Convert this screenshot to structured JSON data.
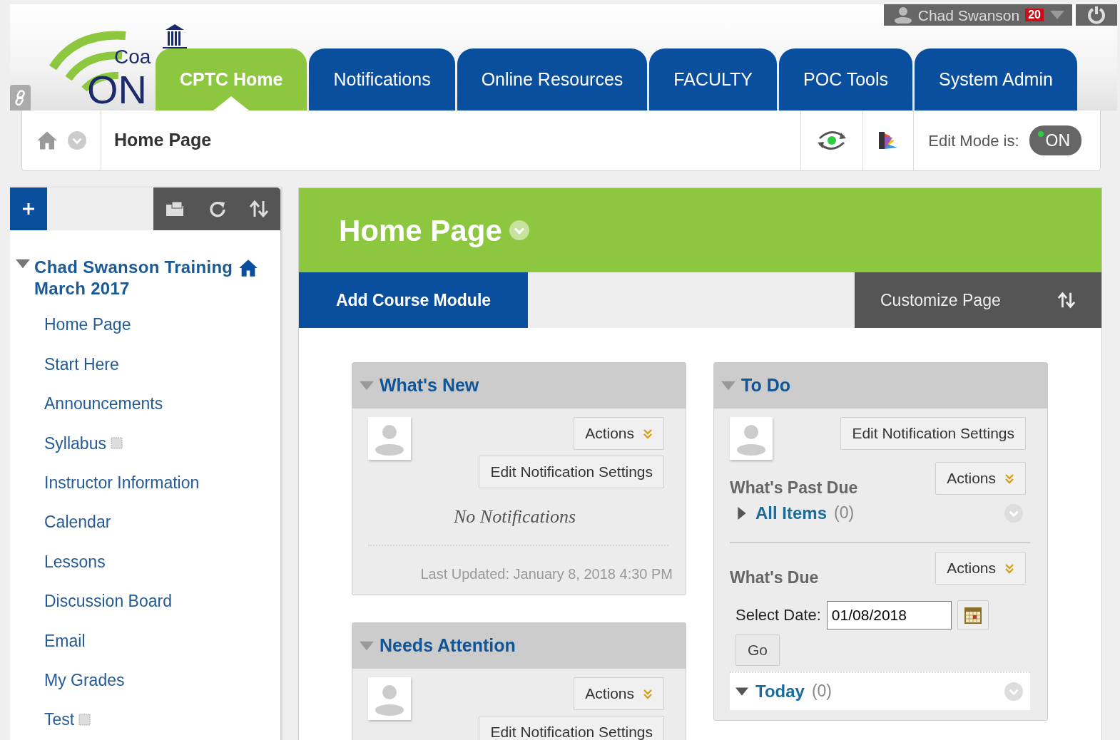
{
  "header": {
    "logo": {
      "text_top": "Coa",
      "text_main": "ON"
    },
    "user": {
      "name": "Chad Swanson",
      "badge": "20"
    },
    "tabs": [
      {
        "label": "CPTC Home",
        "selected": true
      },
      {
        "label": "Notifications",
        "selected": false
      },
      {
        "label": "Online Resources",
        "selected": false
      },
      {
        "label": "FACULTY",
        "selected": false
      },
      {
        "label": "POC Tools",
        "selected": false
      },
      {
        "label": "System Admin",
        "selected": false
      }
    ]
  },
  "breadcrumb": {
    "label": "Home Page",
    "edit_mode": {
      "label": "Edit Mode is:",
      "toggle": "ON",
      "on": true
    }
  },
  "sidebar": {
    "course": {
      "title": "Chad Swanson Training March 2017",
      "expanded": true
    },
    "items": [
      {
        "label": "Home Page",
        "empty": false
      },
      {
        "label": "Start Here",
        "empty": false
      },
      {
        "label": "Announcements",
        "empty": false
      },
      {
        "label": "Syllabus",
        "empty": true
      },
      {
        "label": "Instructor Information",
        "empty": false
      },
      {
        "label": "Calendar",
        "empty": false
      },
      {
        "label": "Lessons",
        "empty": false
      },
      {
        "label": "Discussion Board",
        "empty": false
      },
      {
        "label": "Email",
        "empty": false
      },
      {
        "label": "My Grades",
        "empty": false
      },
      {
        "label": "Test",
        "empty": true
      }
    ]
  },
  "page": {
    "title": "Home Page",
    "add_button": "Add Course Module",
    "customize_button": "Customize Page"
  },
  "columns": [
    [
      {
        "title": "What's New",
        "expanded": true,
        "actions": "Actions",
        "settings": "Edit Notification Settings",
        "message": "No Notifications",
        "updated": "Last Updated: January 8, 2018 4:30 PM"
      },
      {
        "title": "Needs Attention",
        "expanded": true,
        "actions": "Actions",
        "settings": "Edit Notification Settings"
      }
    ],
    [
      {
        "title": "To Do",
        "expanded": true,
        "settings": "Edit Notification Settings",
        "sections": [
          {
            "heading": "What's Past Due",
            "actions": "Actions",
            "groups": [
              {
                "label": "All Items",
                "count": "(0)",
                "expanded": false
              }
            ]
          },
          {
            "heading": "What's Due",
            "actions": "Actions",
            "date_label": "Select Date:",
            "date_value": "01/08/2018",
            "go": "Go",
            "groups": [
              {
                "label": "Today",
                "count": "(0)",
                "expanded": true
              }
            ]
          }
        ]
      }
    ]
  ]
}
